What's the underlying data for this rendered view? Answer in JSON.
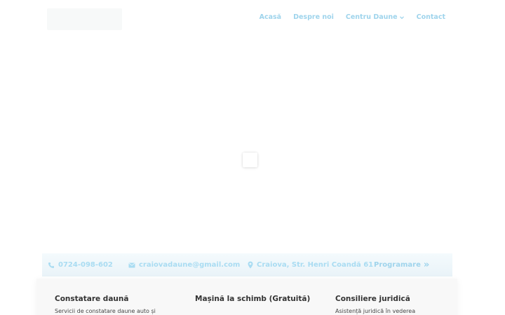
{
  "header": {
    "nav": [
      {
        "label": "Acasă"
      },
      {
        "label": "Despre noi"
      },
      {
        "label": "Centru Daune"
      },
      {
        "label": "Contact"
      }
    ]
  },
  "contact_bar": {
    "phone": "0724-098-602",
    "email": "craiovadaune@gmail.com",
    "address": "Craiova, Str. Henri Coandă 61",
    "cta": "Programare",
    "cta_arrow": "»"
  },
  "services": [
    {
      "title": "Constatare daună",
      "text": "Servicii de constatare daune auto și"
    },
    {
      "title": "Mașină la schimb (Gratuită)",
      "text": ""
    },
    {
      "title": "Consiliere juridică",
      "text": "Asistență juridică în vederea"
    }
  ],
  "colors": {
    "nav": "#9fd4ec",
    "contact_text": "#a9dcf2",
    "contact_bar_bg": "#eef7fb",
    "heading": "#333333"
  },
  "icons": [
    "phone-icon",
    "envelope-icon",
    "map-pin-icon",
    "chevron-down-icon"
  ]
}
